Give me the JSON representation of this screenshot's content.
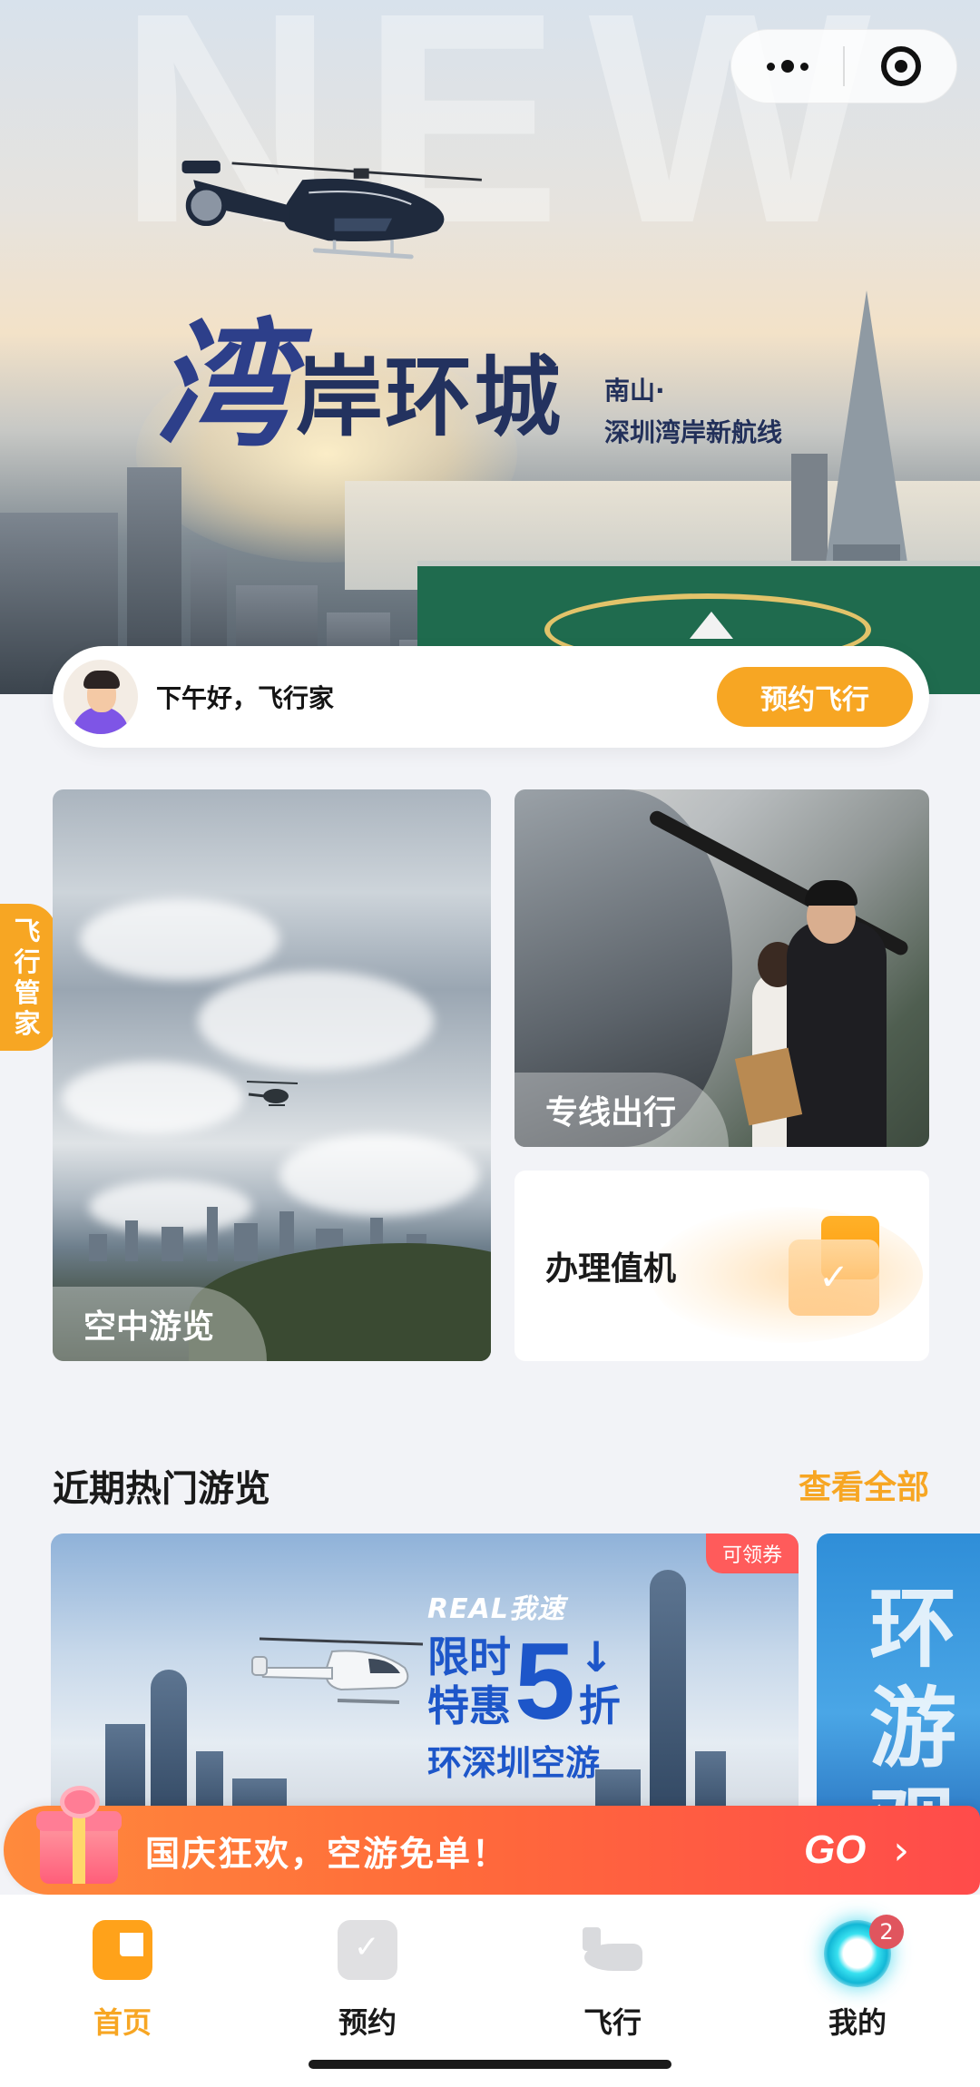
{
  "hero": {
    "watermark": "NEW",
    "title_swirl": "湾",
    "title": "岸环城",
    "subtitle_line1": "南山·",
    "subtitle_line2": "深圳湾岸新航线"
  },
  "capsule": {
    "more_icon": "more-dots-icon",
    "close_icon": "target-circle-icon"
  },
  "greeting": {
    "text": "下午好，飞行家",
    "book_button": "预约飞行"
  },
  "side_tab": {
    "label": "飞行管家"
  },
  "cards": {
    "tour_label": "空中游览",
    "route_label": "专线出行",
    "checkin_label": "办理值机"
  },
  "section": {
    "title": "近期热门游览",
    "see_all": "查看全部"
  },
  "promo": {
    "coupon_tag": "可领券",
    "brand": "REAL我速",
    "line1": "限时",
    "line2": "特惠",
    "discount_number": "5",
    "discount_unit": "折",
    "subtitle": "环深圳空游",
    "next_card_text": "环游观光"
  },
  "banner": {
    "text": "国庆狂欢，空游免单！",
    "cta": "GO",
    "arrow": "›"
  },
  "tabbar": {
    "tabs": [
      {
        "label": "首页",
        "icon": "home-icon",
        "active": true
      },
      {
        "label": "预约",
        "icon": "booking-check-icon",
        "active": false
      },
      {
        "label": "飞行",
        "icon": "helicopter-icon",
        "active": false
      },
      {
        "label": "我的",
        "icon": "profile-orb-icon",
        "active": false,
        "badge": "2"
      }
    ]
  },
  "colors": {
    "accent": "#f7a623",
    "promo_blue": "#1d56c9",
    "banner_red": "#ff4b4b",
    "badge_red": "#e0555e"
  }
}
